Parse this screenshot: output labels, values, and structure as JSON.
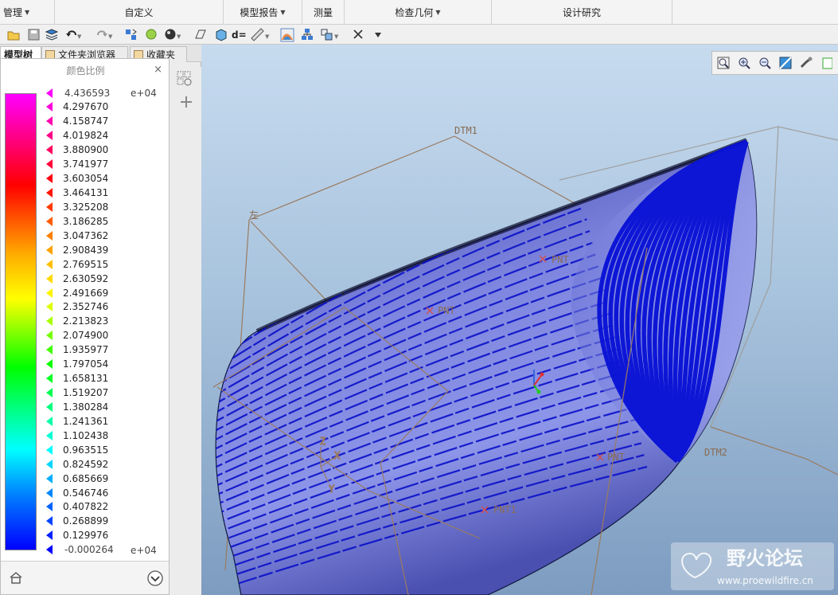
{
  "ribbon": {
    "groups": [
      {
        "label": "管理",
        "has_menu": true
      },
      {
        "label": "自定义",
        "has_menu": false
      },
      {
        "label": "模型报告",
        "has_menu": true
      },
      {
        "label": "测量",
        "has_menu": false
      },
      {
        "label": "检查几何",
        "has_menu": true
      },
      {
        "label": "设计研究",
        "has_menu": false
      }
    ]
  },
  "toolbar": {
    "icons": [
      "open-icon",
      "save-icon",
      "layers-icon",
      "undo-icon",
      "redo-icon",
      "regenerate-icon",
      "sphere-icon",
      "render-sphere-icon",
      "plane-icon",
      "cube-icon",
      "dimension-icon",
      "ruler-icon",
      "color-map-icon",
      "hierarchy-icon",
      "component-icon",
      "close-x-icon",
      "more-icon"
    ],
    "dimension_label": "d="
  },
  "panel": {
    "tabs": [
      {
        "label": "模型树",
        "active": true
      },
      {
        "label": "文件夹浏览器",
        "active": false
      },
      {
        "label": "收藏夹",
        "active": false
      }
    ]
  },
  "color_scale": {
    "title": "颜色比例",
    "close": "×",
    "exponent_top": "e+04",
    "exponent_bottom": "e+04",
    "values": [
      "4.436593",
      "4.297670",
      "4.158747",
      "4.019824",
      "3.880900",
      "3.741977",
      "3.603054",
      "3.464131",
      "3.325208",
      "3.186285",
      "3.047362",
      "2.908439",
      "2.769515",
      "2.630592",
      "2.491669",
      "2.352746",
      "2.213823",
      "2.074900",
      "1.935977",
      "1.797054",
      "1.658131",
      "1.519207",
      "1.380284",
      "1.241361",
      "1.102438",
      "0.963515",
      "0.824592",
      "0.685669",
      "0.546746",
      "0.407822",
      "0.268899",
      "0.129976",
      "-0.000264"
    ],
    "colors": {
      "max": "#ff00ff",
      "min": "#0000ff"
    }
  },
  "viewport": {
    "datums": {
      "dtm1": "DTM1",
      "dtm2": "DTM2",
      "left": "左",
      "pnt1": "PNT1",
      "pnt_a": "PNT",
      "pnt_b": "PNT",
      "pnt_c": "PNT",
      "axis_x": "X",
      "axis_y": "Y",
      "axis_z": "Z"
    },
    "surface_color": "#0a10c8",
    "view_tools": [
      "refit-icon",
      "zoom-in-icon",
      "zoom-out-icon",
      "repaint-icon",
      "orient-icon",
      "saved-views-icon"
    ]
  },
  "watermark": {
    "brand": "野火论坛",
    "url": "www.proewildfire.cn"
  }
}
